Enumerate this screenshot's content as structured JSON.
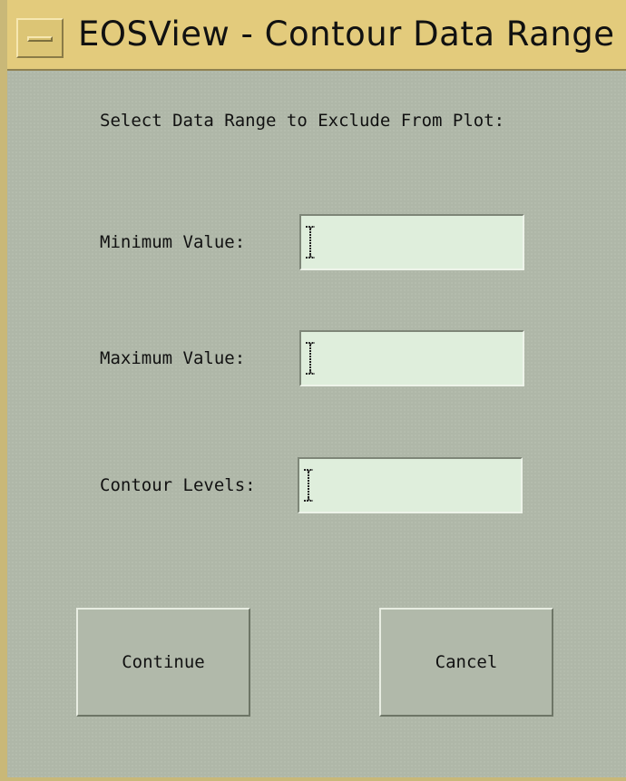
{
  "window": {
    "title": "EOSView - Contour Data Range"
  },
  "dialog": {
    "prompt": "Select Data Range to Exclude From Plot:",
    "fields": [
      {
        "label": "Minimum Value:",
        "value": ""
      },
      {
        "label": "Maximum Value:",
        "value": ""
      },
      {
        "label": "Contour Levels:",
        "value": ""
      }
    ],
    "buttons": {
      "continue_label": "Continue",
      "cancel_label": "Cancel"
    }
  },
  "colors": {
    "title_bar": "#e3cb7c",
    "background": "#afb7a8",
    "field_background": "#dfeedc"
  },
  "icons": {
    "window_menu": "window-menu-icon",
    "text_cursor": "text-cursor-icon"
  }
}
